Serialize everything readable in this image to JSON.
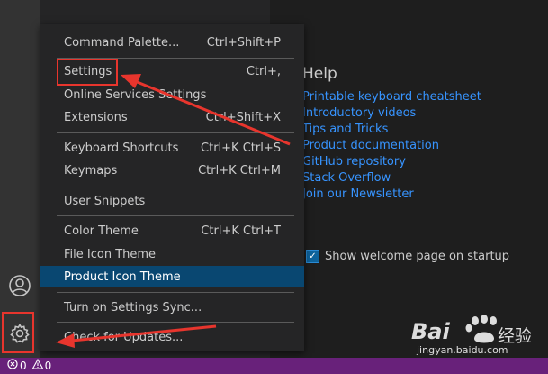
{
  "menu": {
    "items": [
      {
        "label": "Command Palette...",
        "shortcut": "Ctrl+Shift+P"
      },
      {
        "label": "Settings",
        "shortcut": "Ctrl+,"
      },
      {
        "label": "Online Services Settings",
        "shortcut": ""
      },
      {
        "label": "Extensions",
        "shortcut": "Ctrl+Shift+X"
      },
      {
        "label": "Keyboard Shortcuts",
        "shortcut": "Ctrl+K Ctrl+S"
      },
      {
        "label": "Keymaps",
        "shortcut": "Ctrl+K Ctrl+M"
      },
      {
        "label": "User Snippets",
        "shortcut": ""
      },
      {
        "label": "Color Theme",
        "shortcut": "Ctrl+K Ctrl+T"
      },
      {
        "label": "File Icon Theme",
        "shortcut": ""
      },
      {
        "label": "Product Icon Theme",
        "shortcut": ""
      },
      {
        "label": "Turn on Settings Sync...",
        "shortcut": ""
      },
      {
        "label": "Check for Updates...",
        "shortcut": ""
      }
    ]
  },
  "welcome": {
    "help_title": "Help",
    "links": [
      "Printable keyboard cheatsheet",
      "Introductory videos",
      "Tips and Tricks",
      "Product documentation",
      "GitHub repository",
      "Stack Overflow",
      "Join our Newsletter"
    ],
    "startup_label": "Show welcome page on startup",
    "startup_checked": true
  },
  "status_bar": {
    "errors": "0",
    "warnings": "0"
  },
  "activity_bar": {
    "icons": [
      "account-icon",
      "manage-gear-icon"
    ]
  },
  "watermark": {
    "brand": "Bai",
    "brand_cn": "经验",
    "url": "jingyan.baidu.com"
  },
  "colors": {
    "status_bar": "#68217a",
    "active_item": "#094771",
    "link": "#3794ff",
    "annotation": "#e8352d"
  }
}
